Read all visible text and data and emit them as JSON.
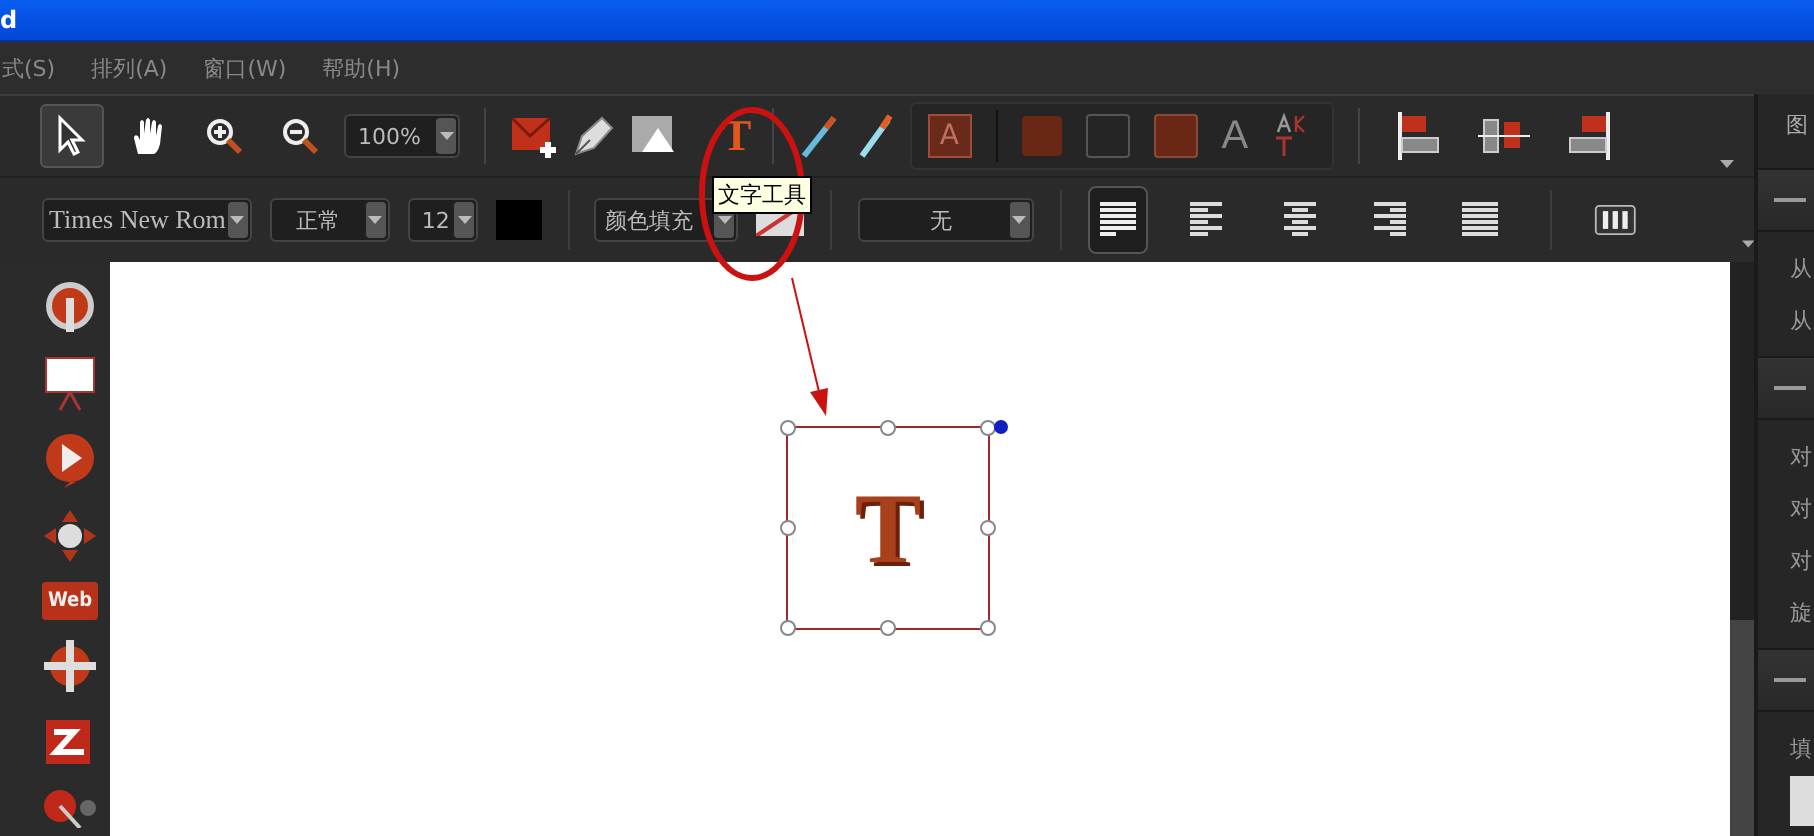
{
  "title_bar": {
    "title": "d"
  },
  "menu": [
    {
      "label": "式(S)"
    },
    {
      "label": "排列(A)"
    },
    {
      "label": "窗口(W)"
    },
    {
      "label": "帮助(H)"
    }
  ],
  "toolbar": {
    "tools": [
      {
        "kind": "select",
        "selected": true
      },
      {
        "kind": "hand",
        "selected": false
      },
      {
        "kind": "zoom_in",
        "selected": false
      },
      {
        "kind": "zoom_out",
        "selected": false
      }
    ],
    "zoom": "100%",
    "text_tool_glyph": "T",
    "tooltip": "文字工具",
    "style_glyphs": [
      "A",
      "A"
    ]
  },
  "format_bar": {
    "font": "Times New Rom",
    "weight": "正常",
    "size": "12",
    "fill_mode": "颜色填充",
    "line_style": "无",
    "paragraph_align": [
      {
        "kind": "fill",
        "selected": true
      },
      {
        "kind": "left",
        "selected": false
      },
      {
        "kind": "center",
        "selected": false
      },
      {
        "kind": "right",
        "selected": false
      },
      {
        "kind": "justify",
        "selected": false
      }
    ]
  },
  "side_tools": {
    "web_label": "Web"
  },
  "canvas": {
    "text_object": "T"
  },
  "right_panel": {
    "header": "图",
    "sections": [
      {
        "labels": [
          "从",
          "从"
        ]
      },
      {
        "labels": [
          "对",
          "对",
          "对",
          "旋"
        ]
      },
      {
        "labels": [
          "填"
        ]
      }
    ]
  }
}
